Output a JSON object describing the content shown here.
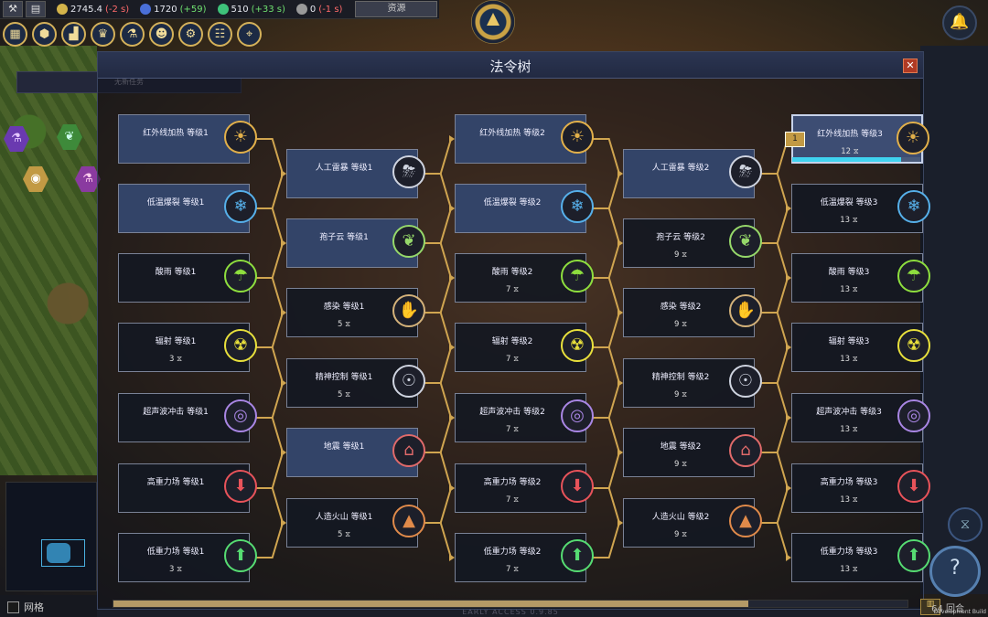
{
  "topbar": {
    "resources": [
      {
        "icon": "gold-coin-icon",
        "color": "#d4b44a",
        "value": "2745.4",
        "delta": "(-2 s)",
        "delta_sign": "neg"
      },
      {
        "icon": "energy-icon",
        "color": "#4a6fd8",
        "value": "1720",
        "delta": "(+59)",
        "delta_sign": "pos"
      },
      {
        "icon": "biomass-icon",
        "color": "#3ec27a",
        "value": "510",
        "delta": "(+33 s)",
        "delta_sign": "pos"
      },
      {
        "icon": "star-icon",
        "color": "#9a9a9a",
        "value": "0",
        "delta": "(-1 s)",
        "delta_sign": "neg"
      }
    ],
    "resources_button": "资源"
  },
  "mission_label": "无新任务",
  "panel_title": "法令树",
  "grid_label": "网格",
  "footer_text": "EARLY ACCESS 0.9.85",
  "turn_text": "64 回合",
  "dev_text": "Development Build",
  "side_badge": "1",
  "progress_fraction": 0.85,
  "scroll_fraction": 0.8,
  "nodes": [
    {
      "label": "红外线加热 等级1",
      "cost": "",
      "icon": "☀",
      "color": "#e2b04a"
    },
    {
      "label": "低温爆裂 等级1",
      "cost": "",
      "icon": "❄",
      "color": "#56b0ea"
    },
    {
      "label": "酸雨 等级1",
      "cost": "",
      "icon": "☂",
      "color": "#8ede3e"
    },
    {
      "label": "辐射 等级1",
      "cost": "3 ⧖",
      "icon": "☢",
      "color": "#e8e03c"
    },
    {
      "label": "超声波冲击 等级1",
      "cost": "",
      "icon": "◎",
      "color": "#a986e4"
    },
    {
      "label": "高重力场 等级1",
      "cost": "",
      "icon": "⬇",
      "color": "#e8535a"
    },
    {
      "label": "低重力场 等级1",
      "cost": "3 ⧖",
      "icon": "⬆",
      "color": "#56dc72"
    },
    {
      "label": "人工雷暴 等级1",
      "cost": "",
      "icon": "⛈",
      "color": "#cfd4e0"
    },
    {
      "label": "孢子云 等级1",
      "cost": "",
      "icon": "❦",
      "color": "#96d86a"
    },
    {
      "label": "感染 等级1",
      "cost": "5 ⧖",
      "icon": "✋",
      "color": "#d4b27a"
    },
    {
      "label": "精神控制 等级1",
      "cost": "5 ⧖",
      "icon": "☉",
      "color": "#cfd4e0"
    },
    {
      "label": "地震 等级1",
      "cost": "",
      "icon": "⌂",
      "color": "#e06a6a"
    },
    {
      "label": "人造火山 等级1",
      "cost": "5 ⧖",
      "icon": "▲",
      "color": "#e08a4a"
    },
    {
      "label": "红外线加热 等级2",
      "cost": "",
      "icon": "☀",
      "color": "#e2b04a"
    },
    {
      "label": "低温爆裂 等级2",
      "cost": "",
      "icon": "❄",
      "color": "#56b0ea"
    },
    {
      "label": "酸雨 等级2",
      "cost": "7 ⧖",
      "icon": "☂",
      "color": "#8ede3e"
    },
    {
      "label": "辐射 等级2",
      "cost": "7 ⧖",
      "icon": "☢",
      "color": "#e8e03c"
    },
    {
      "label": "超声波冲击 等级2",
      "cost": "7 ⧖",
      "icon": "◎",
      "color": "#a986e4"
    },
    {
      "label": "高重力场 等级2",
      "cost": "7 ⧖",
      "icon": "⬇",
      "color": "#e8535a"
    },
    {
      "label": "低重力场 等级2",
      "cost": "7 ⧖",
      "icon": "⬆",
      "color": "#56dc72"
    },
    {
      "label": "人工雷暴 等级2",
      "cost": "",
      "icon": "⛈",
      "color": "#cfd4e0"
    },
    {
      "label": "孢子云 等级2",
      "cost": "9 ⧖",
      "icon": "❦",
      "color": "#96d86a"
    },
    {
      "label": "感染 等级2",
      "cost": "9 ⧖",
      "icon": "✋",
      "color": "#d4b27a"
    },
    {
      "label": "精神控制 等级2",
      "cost": "9 ⧖",
      "icon": "☉",
      "color": "#cfd4e0"
    },
    {
      "label": "地震 等级2",
      "cost": "9 ⧖",
      "icon": "⌂",
      "color": "#e06a6a"
    },
    {
      "label": "人造火山 等级2",
      "cost": "9 ⧖",
      "icon": "▲",
      "color": "#e08a4a"
    },
    {
      "label": "红外线加热 等级3",
      "cost": "12 ⧖",
      "icon": "☀",
      "color": "#e2b04a"
    },
    {
      "label": "低温爆裂 等级3",
      "cost": "13 ⧖",
      "icon": "❄",
      "color": "#56b0ea"
    },
    {
      "label": "酸雨 等级3",
      "cost": "13 ⧖",
      "icon": "☂",
      "color": "#8ede3e"
    },
    {
      "label": "辐射 等级3",
      "cost": "13 ⧖",
      "icon": "☢",
      "color": "#e8e03c"
    },
    {
      "label": "超声波冲击 等级3",
      "cost": "13 ⧖",
      "icon": "◎",
      "color": "#a986e4"
    },
    {
      "label": "高重力场 等级3",
      "cost": "13 ⧖",
      "icon": "⬇",
      "color": "#e8535a"
    },
    {
      "label": "低重力场 等级3",
      "cost": "13 ⧖",
      "icon": "⬆",
      "color": "#56dc72"
    }
  ]
}
